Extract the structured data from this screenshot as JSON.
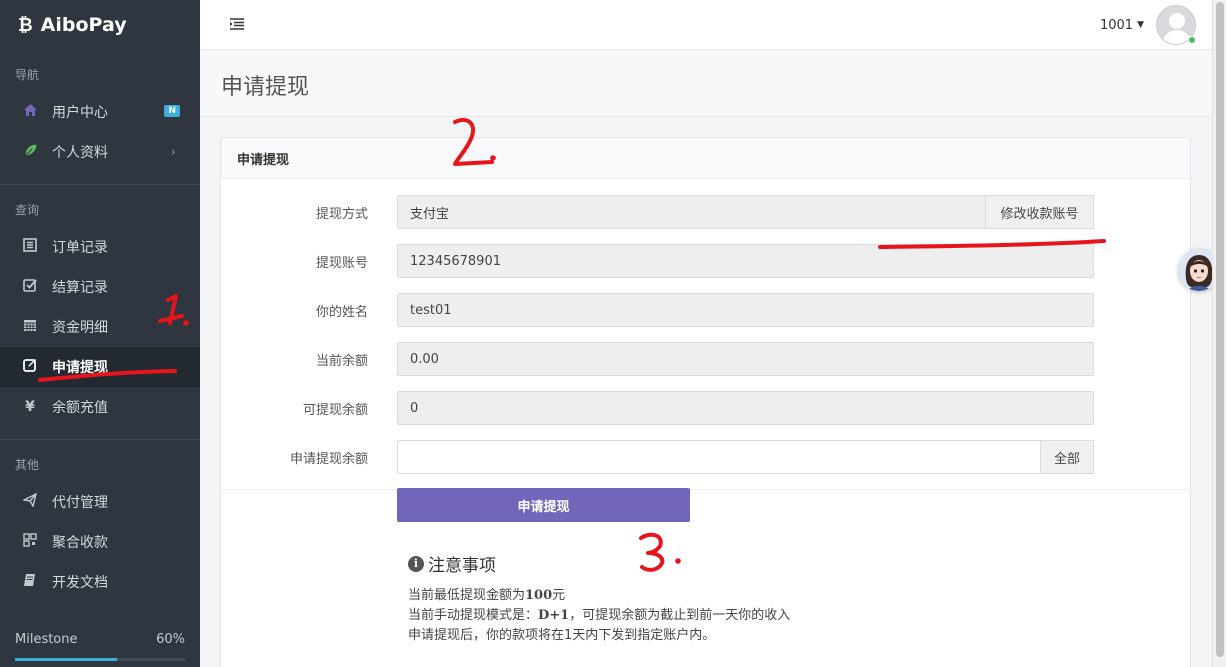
{
  "brand": {
    "name": "AiboPay"
  },
  "sidebar": {
    "sections": [
      {
        "title": "导航"
      },
      {
        "title": "查询"
      },
      {
        "title": "其他"
      }
    ],
    "nav_items": [
      {
        "label": "用户中心",
        "icon": "home-icon",
        "badge": "N"
      },
      {
        "label": "个人资料",
        "icon": "leaf-icon"
      },
      {
        "label": "订单记录",
        "icon": "list-icon"
      },
      {
        "label": "结算记录",
        "icon": "check-square-icon"
      },
      {
        "label": "资金明细",
        "icon": "calendar-icon"
      },
      {
        "label": "申请提现",
        "icon": "edit-icon",
        "active": true
      },
      {
        "label": "余额充值",
        "icon": "yen-icon"
      },
      {
        "label": "代付管理",
        "icon": "send-icon"
      },
      {
        "label": "聚合收款",
        "icon": "qrcode-icon"
      },
      {
        "label": "开发文档",
        "icon": "book-icon"
      }
    ],
    "milestone": {
      "label": "Milestone",
      "percent_text": "60%",
      "progress": 0.6
    }
  },
  "header": {
    "user": "1001"
  },
  "page": {
    "title": "申请提现",
    "panel_title": "申请提现"
  },
  "form": {
    "method": {
      "label": "提现方式",
      "value": "支付宝",
      "button": "修改收款账号"
    },
    "account": {
      "label": "提现账号",
      "value": "12345678901"
    },
    "name": {
      "label": "你的姓名",
      "value": "test01"
    },
    "balance": {
      "label": "当前余额",
      "value": "0.00"
    },
    "available": {
      "label": "可提现余额",
      "value": "0"
    },
    "amount": {
      "label": "申请提现余额",
      "value": "",
      "button": "全部"
    },
    "submit": "申请提现"
  },
  "notice": {
    "title": "注意事项",
    "line1_prefix": "当前最低提现金额为",
    "line1_amount": "100",
    "line1_suffix": "元",
    "line2_prefix": "当前手动提现模式是：",
    "line2_mode": "D+1",
    "line2_suffix": "，可提现余额为截止到前一天你的收入",
    "line3": "申请提现后，你的款项将在1天内下发到指定账户内。"
  },
  "annotations": [
    "1.",
    "2.",
    "3."
  ],
  "colors": {
    "sidebar_bg": "#2f3640",
    "accent": "#7266ba",
    "annotation": "#e8141b"
  }
}
